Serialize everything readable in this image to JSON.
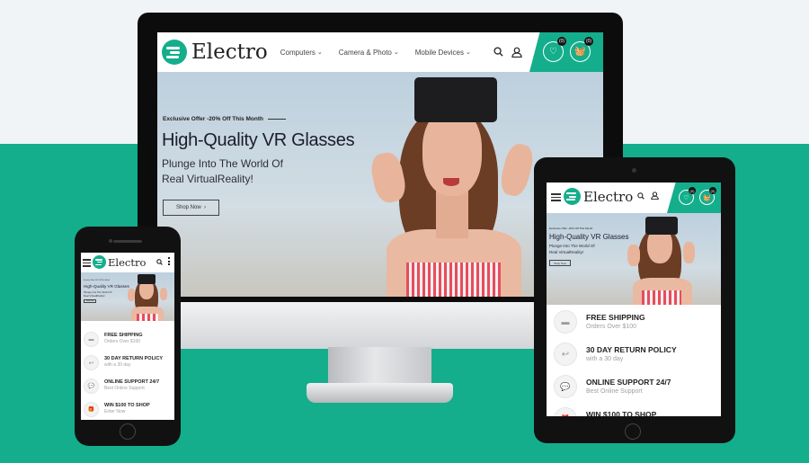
{
  "brand": {
    "name": "Electro"
  },
  "nav": [
    {
      "label": "Computers"
    },
    {
      "label": "Camera & Photo"
    },
    {
      "label": "Mobile Devices"
    }
  ],
  "cart": {
    "wishlist_count": "(0)",
    "cart_count": "(0)"
  },
  "hero": {
    "offer": "Exclusive Offer -20% Off This Month",
    "title": "High-Quality VR Glasses",
    "subtitle_line1": "Plunge Into The World Of",
    "subtitle_line2": "Real VirtualReality!",
    "cta": "Shop Now",
    "cta_icon": "›"
  },
  "features": [
    {
      "title": "FREE SHIPPING",
      "subtitle": "Orders Over $100",
      "icon": "truck-icon"
    },
    {
      "title": "30 DAY RETURN POLICY",
      "subtitle": "with a 30 day",
      "icon": "return-icon"
    },
    {
      "title": "ONLINE SUPPORT 24/7",
      "subtitle": "Best Online Support",
      "icon": "chat-icon"
    },
    {
      "title": "WIN $100 TO SHOP",
      "subtitle": "Enter Now",
      "icon": "gift-icon"
    }
  ],
  "colors": {
    "accent": "#14ae8c",
    "device": "#111111"
  }
}
